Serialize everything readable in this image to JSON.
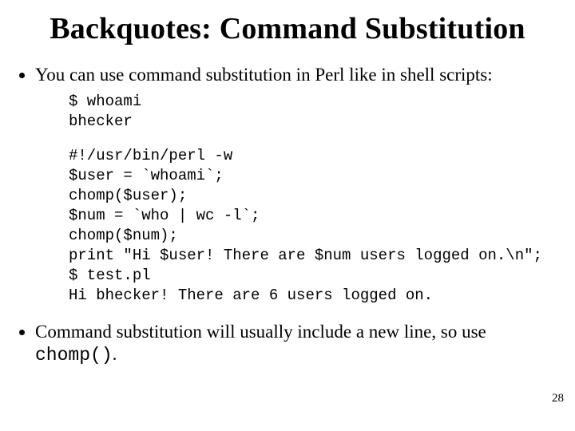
{
  "title": "Backquotes: Command Substitution",
  "bullet1": "You can use command substitution in Perl like in shell scripts:",
  "code1": "$ whoami\nbhecker",
  "code2": "#!/usr/bin/perl -w\n$user = `whoami`;\nchomp($user);\n$num = `who | wc -l`;\nchomp($num);\nprint \"Hi $user! There are $num users logged on.\\n\";\n$ test.pl\nHi bhecker! There are 6 users logged on.",
  "bullet2_prefix": "Command substitution will usually include a new line, so use ",
  "bullet2_code": "chomp()",
  "bullet2_suffix": ".",
  "page_number": "28"
}
